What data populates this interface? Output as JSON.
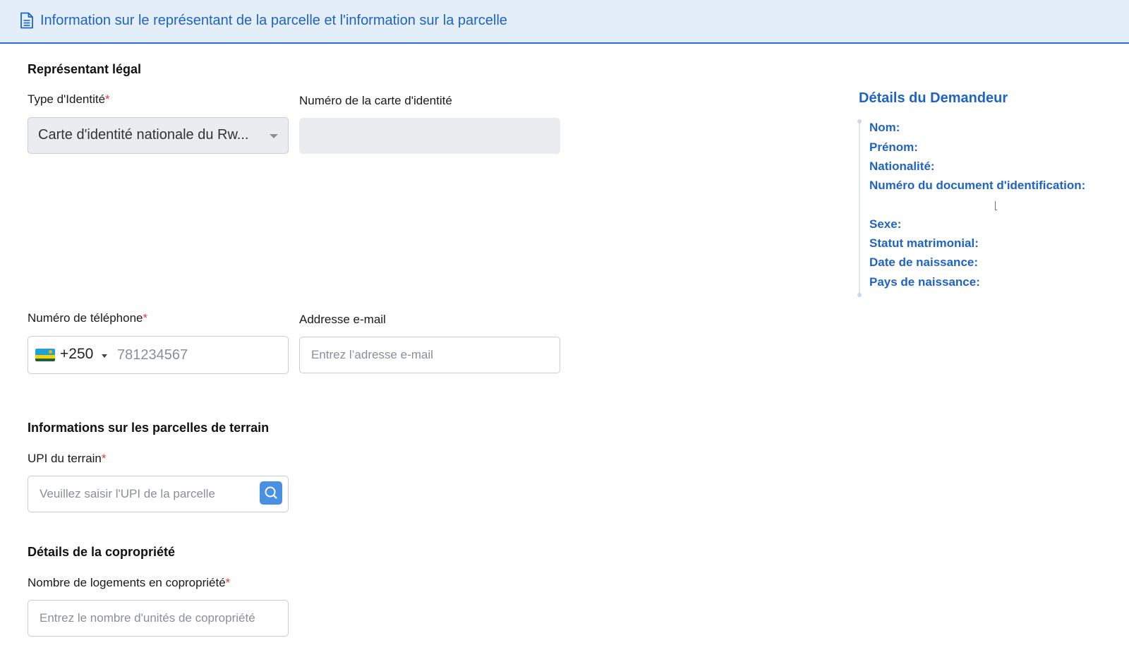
{
  "header": {
    "title": "Information sur le représentant de la parcelle et l'information sur la parcelle",
    "icon": "document-icon"
  },
  "legal_rep": {
    "section_title": "Représentant légal",
    "id_type_label": "Type d'Identité",
    "id_type_value": "Carte d'identité nationale du Rw...",
    "id_number_label": "Numéro de la carte d'identité",
    "id_number_value": ""
  },
  "contact": {
    "phone_label": "Numéro de téléphone",
    "country_code": "+250",
    "phone_placeholder": "781234567",
    "email_label": "Addresse e-mail",
    "email_placeholder": "Entrez l’adresse e-mail"
  },
  "parcel": {
    "section_title": "Informations sur les parcelles de terrain",
    "upi_label": "UPI du terrain",
    "upi_placeholder": "Veuillez saisir l'UPI de la parcelle"
  },
  "coownership": {
    "section_title": "Détails de la copropriété",
    "units_label": "Nombre de logements en copropriété",
    "units_placeholder": "Entrez le nombre d'unités de copropriété"
  },
  "required_marker": "*",
  "applicant_details": {
    "title": "Détails du Demandeur",
    "fields": [
      "Nom:",
      "Prénom:",
      "Nationalité:",
      "Numéro du document d'identification:",
      "Sexe:",
      "Statut matrimonial:",
      "Date de naissance:",
      "Pays de naissance:"
    ]
  },
  "colors": {
    "accent": "#1f63c6",
    "header_bg": "#e3eef9",
    "required": "#e53935",
    "search_button": "#4a90e2"
  }
}
